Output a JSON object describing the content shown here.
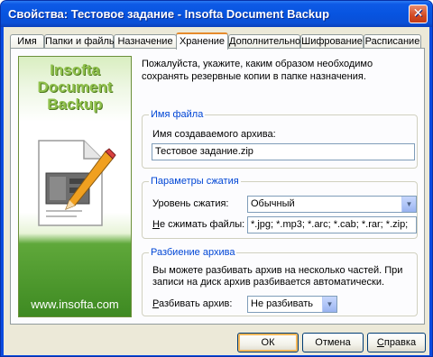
{
  "window": {
    "title": "Свойства: Тестовое задание - Insofta Document Backup",
    "close_glyph": "✕"
  },
  "tabs": [
    {
      "label": "Имя",
      "active": false
    },
    {
      "label": "Папки и файлы",
      "active": false
    },
    {
      "label": "Назначение",
      "active": false
    },
    {
      "label": "Хранение",
      "active": true
    },
    {
      "label": "Дополнительно",
      "active": false
    },
    {
      "label": "Шифрование",
      "active": false
    },
    {
      "label": "Расписание",
      "active": false
    }
  ],
  "banner": {
    "logo_line1": "Insofta",
    "logo_line2": "Document",
    "logo_line3": "Backup",
    "url": "www.insofta.com",
    "icon": "document-with-pencil-icon"
  },
  "intro": "Пожалуйста, укажите, каким образом необходимо сохранять резервные копии в папке назначения.",
  "file_name_group": {
    "title": "Имя файла",
    "label": "Имя создаваемого архива:",
    "value": "Тестовое задание.zip"
  },
  "compression_group": {
    "title": "Параметры сжатия",
    "level_label": "Уровень сжатия:",
    "level_value": "Обычный",
    "exclude_label_u": "Н",
    "exclude_label_rest": "е сжимать файлы:",
    "exclude_value": "*.jpg; *.mp3; *.arc; *.cab; *.rar; *.zip;"
  },
  "split_group": {
    "title": "Разбиение архива",
    "description": "Вы можете разбивать архив на несколько частей. При записи на диск архив разбивается автоматически.",
    "split_label_u": "Р",
    "split_label_rest": "азбивать архив:",
    "split_value": "Не разбивать"
  },
  "buttons": {
    "ok": "ОК",
    "cancel": "Отмена",
    "help_u": "С",
    "help_rest": "правка"
  },
  "colors": {
    "titlebar": "#0754e0",
    "group_title": "#0046d5",
    "active_tab_accent": "#e68b2c",
    "banner_green": "#3e8a22"
  }
}
